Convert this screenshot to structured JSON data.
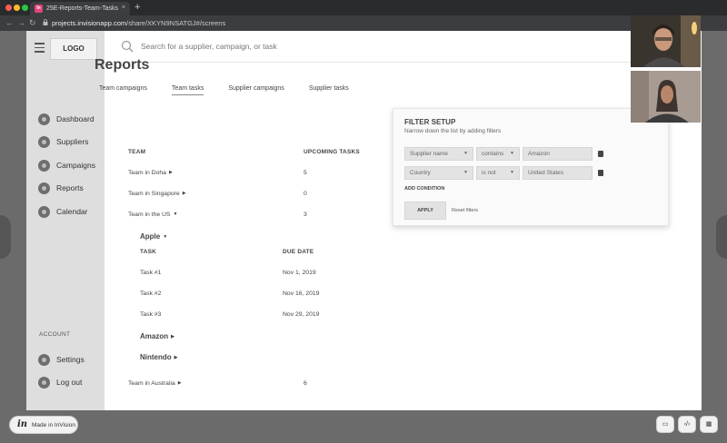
{
  "browser": {
    "tab_title": "25E-Reports-Team-Tasks",
    "tab_favicon": "In",
    "tab_close": "×",
    "new_tab": "+",
    "url_host": "projects.invisionapp.com",
    "url_path": "/share/XKYN9NSATGJ#/screens"
  },
  "sidebar": {
    "logo": "LOGO",
    "items": [
      {
        "label": "Dashboard"
      },
      {
        "label": "Suppliers"
      },
      {
        "label": "Campaigns"
      },
      {
        "label": "Reports"
      },
      {
        "label": "Calendar"
      }
    ],
    "account_label": "ACCOUNT",
    "account_items": [
      {
        "label": "Settings"
      },
      {
        "label": "Log out"
      }
    ]
  },
  "search": {
    "placeholder": "Search for a supplier, campaign, or task"
  },
  "main": {
    "title": "Reports",
    "tabs": [
      {
        "label": "Team campaigns"
      },
      {
        "label": "Team tasks"
      },
      {
        "label": "Supplier campaigns"
      },
      {
        "label": "Supplier tasks"
      }
    ],
    "col_team": "TEAM",
    "col_upcoming": "UPCOMING TASKS",
    "teams": [
      {
        "name": "Team in Doha",
        "count": "5"
      },
      {
        "name": "Team in Singapore",
        "count": "0"
      },
      {
        "name": "Team in the US",
        "count": "3"
      },
      {
        "name": "Team in Australia",
        "count": "6"
      }
    ],
    "group_apple": "Apple",
    "col_task": "TASK",
    "col_due": "DUE DATE",
    "tasks": [
      {
        "name": "Task #1",
        "due": "Nov 1, 2019"
      },
      {
        "name": "Task #2",
        "due": "Nov 16, 2019"
      },
      {
        "name": "Task #3",
        "due": "Nov 29, 2019"
      }
    ],
    "group_amazon": "Amazon",
    "group_nintendo": "Nintendo"
  },
  "filter": {
    "title": "FILTER SETUP",
    "subtitle": "Narrow down the list by adding filters",
    "close": "×",
    "rows": [
      {
        "field": "Supplier name",
        "op": "contains",
        "value": "Amazon"
      },
      {
        "field": "Country",
        "op": "is not",
        "value": "United States"
      }
    ],
    "add_condition": "ADD CONDITION",
    "apply": "APPLY",
    "reset": "Reset filters"
  },
  "bottom": {
    "made_in": "Made in InVision",
    "in_logo": "in"
  },
  "colors": {
    "sidebar_bg": "#dedede",
    "filter_bg": "#fafafa",
    "chrome_bg": "#2a2b2d",
    "outer_bg": "#6b6b6b"
  }
}
